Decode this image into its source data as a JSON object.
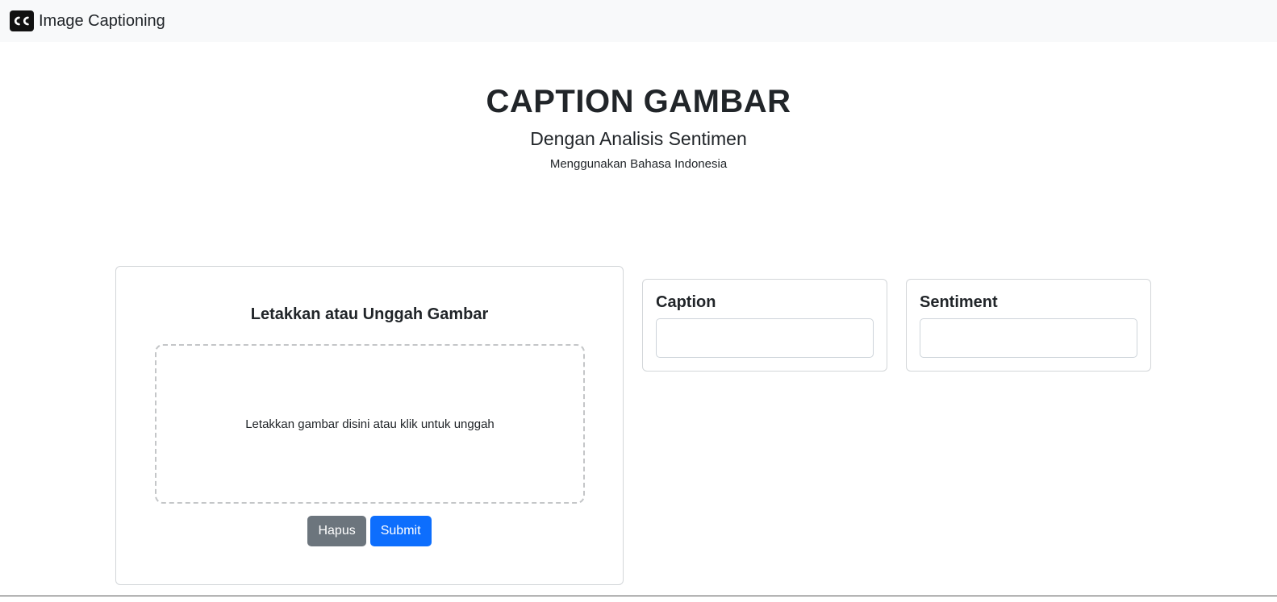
{
  "navbar": {
    "brand_label": "Image Captioning",
    "brand_icon": "closed-captions-icon"
  },
  "hero": {
    "title": "CAPTION GAMBAR",
    "subtitle": "Dengan Analisis Sentimen",
    "note": "Menggunakan Bahasa Indonesia"
  },
  "upload": {
    "heading": "Letakkan atau Unggah Gambar",
    "dropzone_text": "Letakkan gambar disini atau klik untuk unggah",
    "clear_label": "Hapus",
    "submit_label": "Submit"
  },
  "results": {
    "caption_label": "Caption",
    "caption_value": "",
    "sentiment_label": "Sentiment",
    "sentiment_value": ""
  },
  "colors": {
    "navbar_bg": "#f8f9fa",
    "primary": "#0d6efd",
    "secondary": "#6c757d",
    "text": "#212529"
  }
}
